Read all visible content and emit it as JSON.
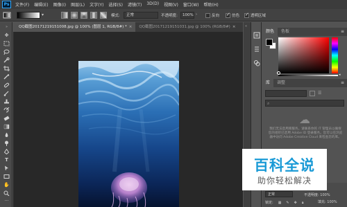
{
  "app": {
    "logo_text": "Ps"
  },
  "menu": [
    "文件(F)",
    "编辑(E)",
    "图像(I)",
    "图层(L)",
    "文字(Y)",
    "选择(S)",
    "滤镜(T)",
    "3D(D)",
    "视图(V)",
    "窗口(W)",
    "帮助(H)"
  ],
  "options_bar": {
    "mode_label": "模式:",
    "mode_value": "正常",
    "opacity_label": "不透明度:",
    "opacity_value": "100%",
    "reverse_label": "反向",
    "reverse_checked": false,
    "dither_label": "仿色",
    "dither_checked": true,
    "transparency_label": "透明区域",
    "transparency_checked": true
  },
  "tabs": [
    {
      "label": "QQ截图20171219151008.jpg @ 100% (图层 1, RGB/8#) *",
      "active": true,
      "close": "×"
    },
    {
      "label": "QQ截图20171219151031.jpg @ 100% (RGB/8#)",
      "active": false,
      "close": "×"
    }
  ],
  "tools": [
    "move-tool",
    "marquee-tool",
    "lasso-tool",
    "quick-select-tool",
    "crop-tool",
    "eyedropper-tool",
    "healing-brush-tool",
    "brush-tool",
    "clone-stamp-tool",
    "history-brush-tool",
    "eraser-tool",
    "gradient-tool",
    "blur-tool",
    "dodge-tool",
    "pen-tool",
    "type-tool",
    "path-select-tool",
    "rectangle-tool",
    "hand-tool",
    "zoom-tool"
  ],
  "panels": {
    "color_tabs": [
      "颜色",
      "色板"
    ],
    "library_tabs": [
      "库",
      "调整"
    ],
    "library_message": "我们无法启用库服务。请联系你的 IT 管理员以确保您的组织已启用 Adobe ID 登录服务。您可以在浏览器中访问 Adobe Creative Cloud 来检查您的库。",
    "layer_kind": "正常",
    "layer_opacity_label": "不透明度: 100%",
    "lock_label": "锁定:",
    "fill_label": "填充: 100%"
  },
  "watermark": {
    "title": "百科全说",
    "subtitle": "助你轻松解决"
  },
  "colors": {
    "foreground": "#000000",
    "background": "#ffffff",
    "accent": "#31a8ff",
    "watermark_blue": "#1a9ad6"
  }
}
